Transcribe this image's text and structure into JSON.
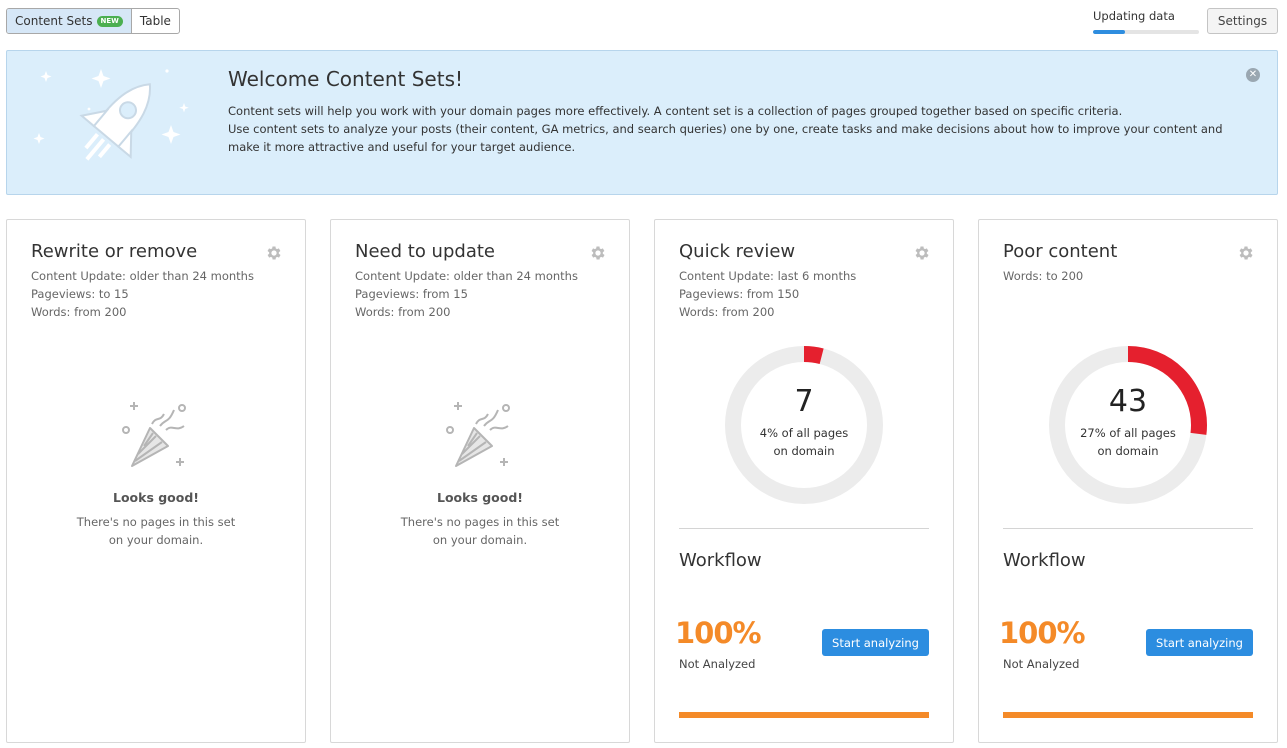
{
  "toolbar": {
    "tabs": [
      {
        "label": "Content Sets",
        "badge": "new",
        "active": true
      },
      {
        "label": "Table",
        "active": false
      }
    ],
    "updating": {
      "label": "Updating data",
      "progress": 0.3
    },
    "settings_label": "Settings"
  },
  "banner": {
    "title": "Welcome Content Sets!",
    "line1": "Content sets will help you work with your domain pages more effectively. A content set is a collection of pages grouped together based on specific criteria.",
    "line2": "Use content sets to analyze your posts (their content, GA metrics, and search queries) one by one, create tasks and make decisions about how to improve your content and make it more attractive and useful for your target audience.",
    "close_icon": "close-icon"
  },
  "cards": [
    {
      "title": "Rewrite or remove",
      "criteria": [
        "Content Update: older than 24 months",
        "Pageviews: to 15",
        "Words: from 200"
      ],
      "empty_title": "Looks good!",
      "empty_line1": "There's no pages in this set",
      "empty_line2": "on your domain."
    },
    {
      "title": "Need to update",
      "criteria": [
        "Content Update: older than 24 months",
        "Pageviews: from 15",
        "Words: from 200"
      ],
      "empty_title": "Looks good!",
      "empty_line1": "There's no pages in this set",
      "empty_line2": "on your domain."
    },
    {
      "title": "Quick review",
      "criteria": [
        "Content Update: last 6 months",
        "Pageviews: from 150",
        "Words: from 200"
      ],
      "count": "7",
      "percent_line1": "4% of all pages",
      "percent_line2": "on domain",
      "percent_value": 4,
      "workflow_title": "Workflow",
      "workflow_pct": "100%",
      "workflow_label": "Not Analyzed",
      "button_label": "Start analyzing"
    },
    {
      "title": "Poor content",
      "criteria": [
        "Words: to 200"
      ],
      "count": "43",
      "percent_line1": "27% of all pages",
      "percent_line2": "on domain",
      "percent_value": 27,
      "workflow_title": "Workflow",
      "workflow_pct": "100%",
      "workflow_label": "Not Analyzed",
      "button_label": "Start analyzing"
    }
  ],
  "colors": {
    "accent_blue": "#2c8de0",
    "donut_red": "#e5202e",
    "donut_track": "#ececec",
    "workflow_orange": "#f48a28",
    "banner_bg": "#dbeefb"
  }
}
